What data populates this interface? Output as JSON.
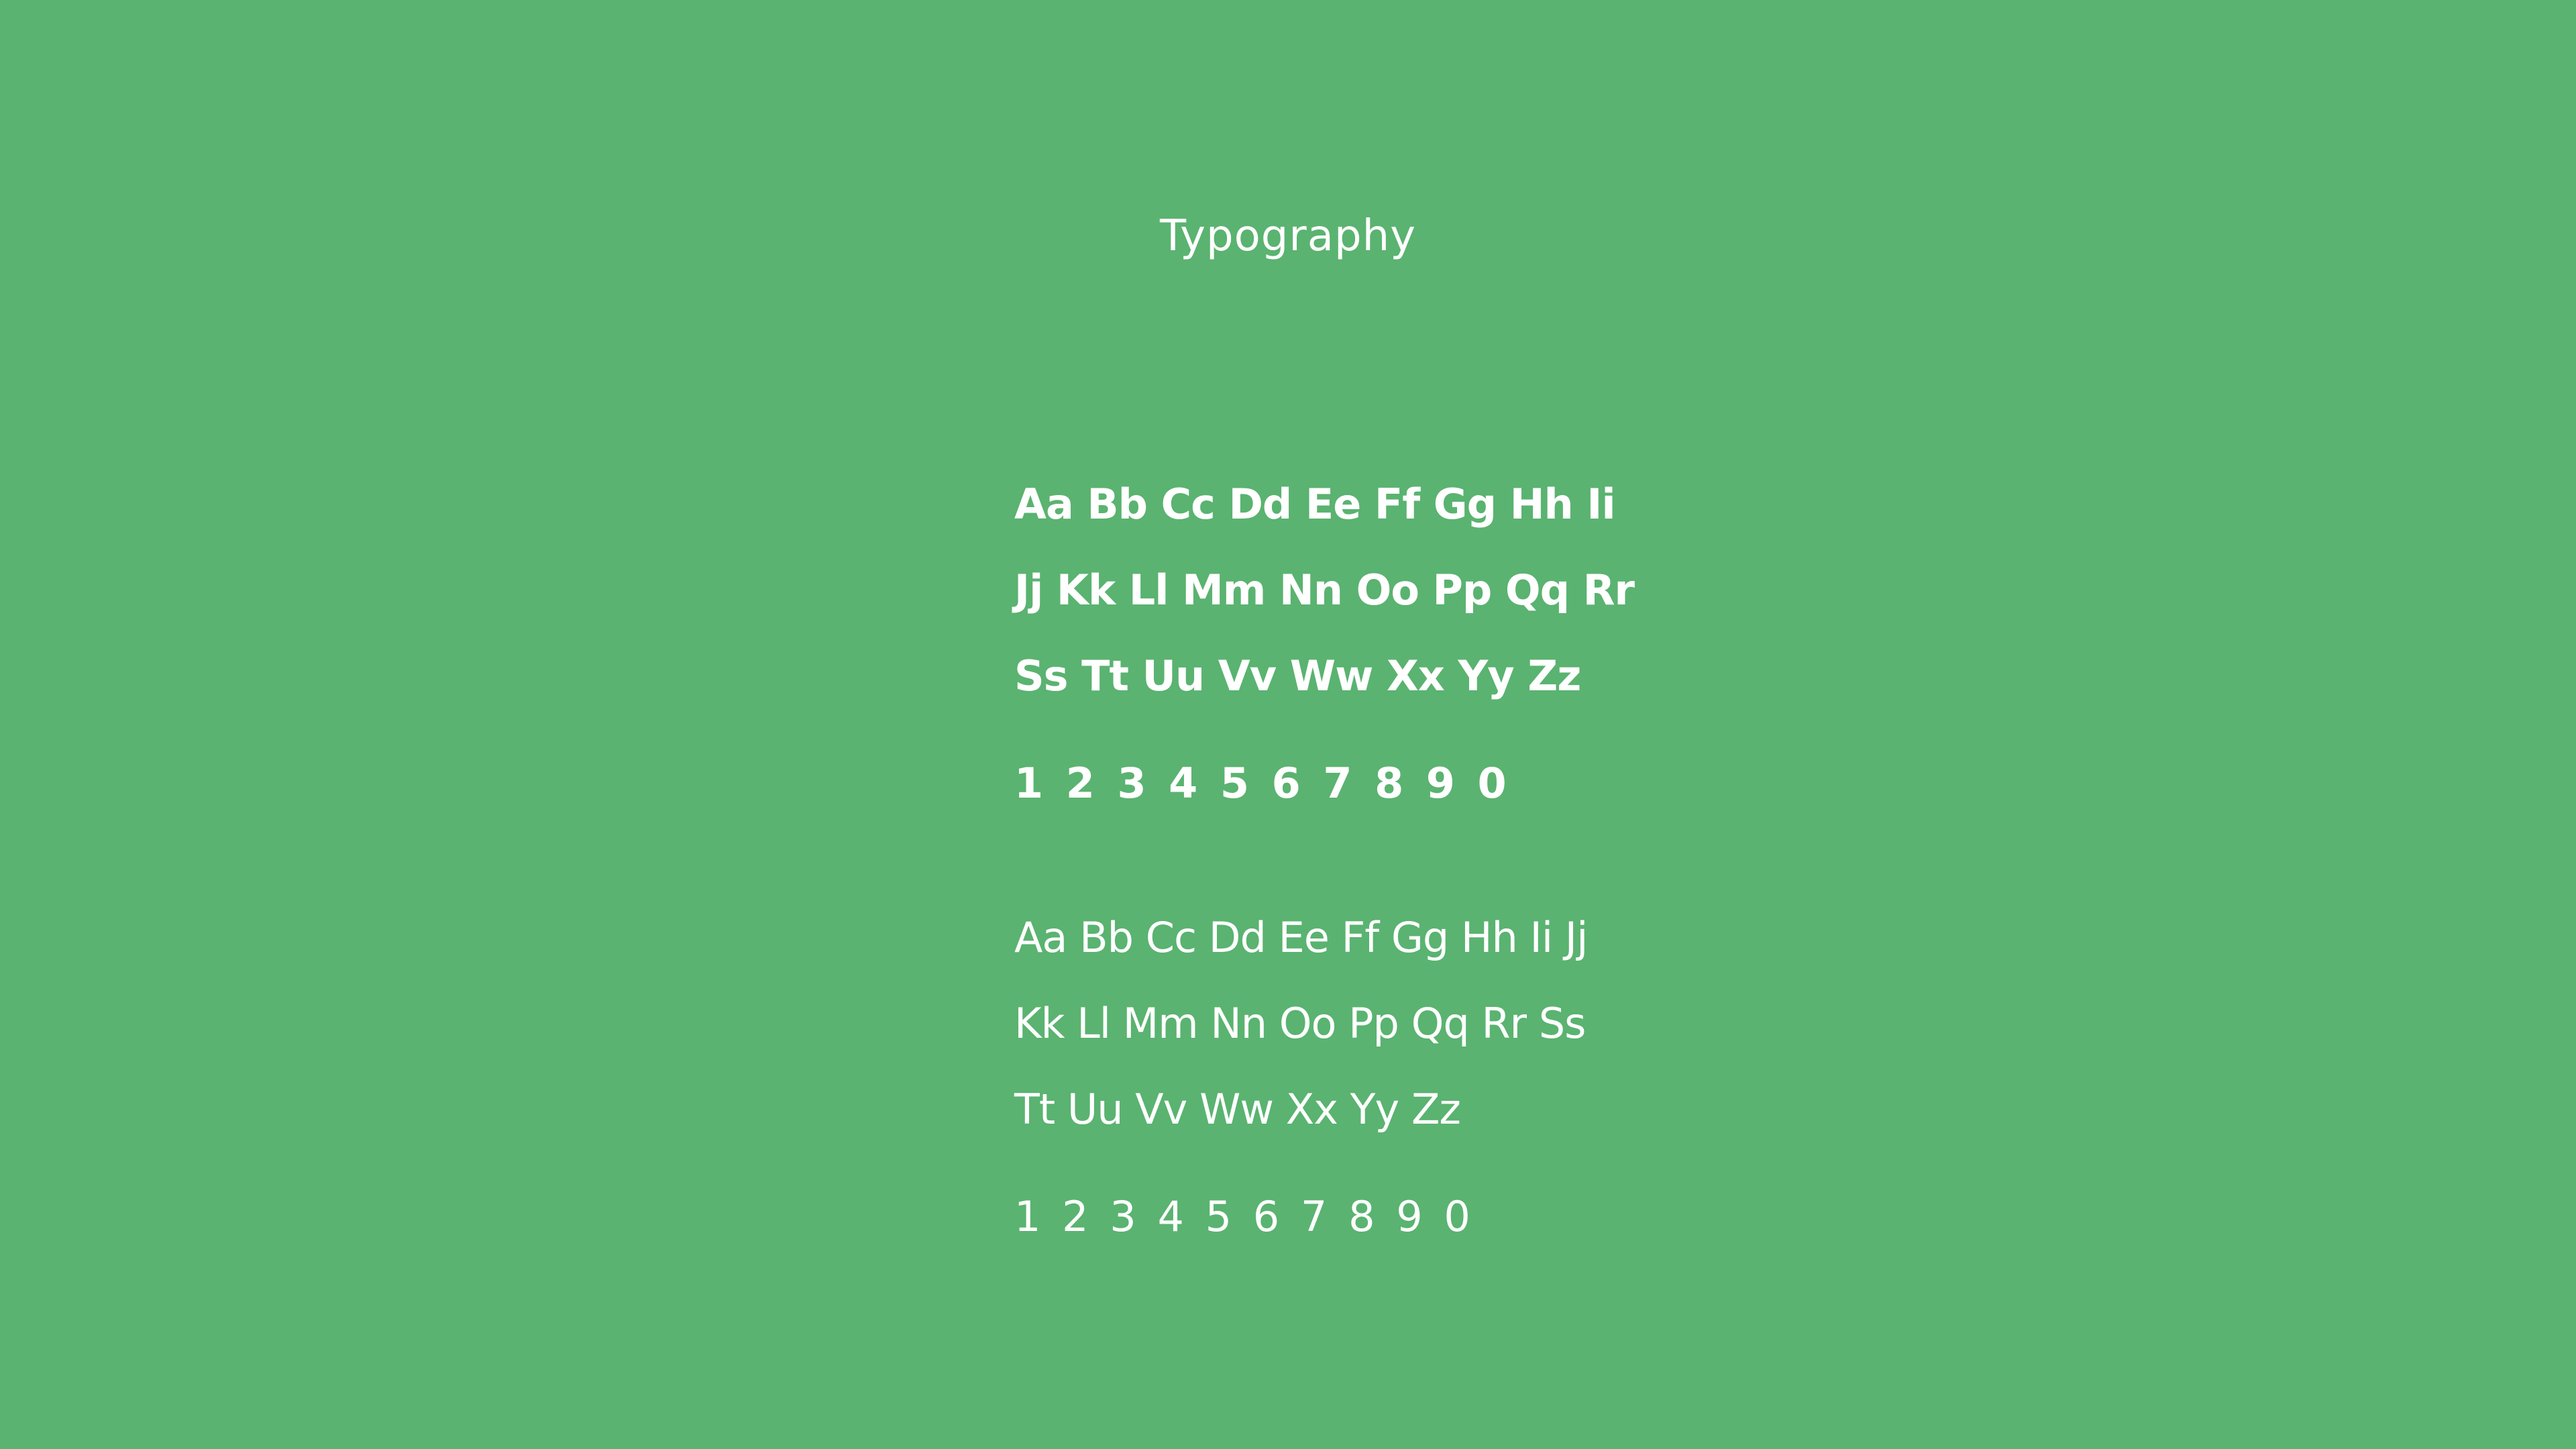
{
  "slide": {
    "title": "Typography",
    "background_color": "#5ab370",
    "text_color": "#ffffff"
  },
  "bold_specimen": {
    "lines": [
      "Aa Bb Cc Dd Ee Ff Gg Hh Ii",
      "Jj Kk Ll Mm Nn Oo Pp Qq Rr",
      "Ss Tt Uu Vv Ww Xx Yy Zz"
    ],
    "numerals": "1 2 3 4 5 6 7 8 9 0"
  },
  "regular_specimen": {
    "lines": [
      "Aa Bb Cc Dd Ee Ff Gg Hh Ii Jj",
      "Kk Ll Mm Nn Oo Pp Qq Rr Ss",
      "Tt Uu Vv Ww Xx Yy Zz"
    ],
    "numerals": "1 2 3 4 5 6 7 8 9 0"
  }
}
